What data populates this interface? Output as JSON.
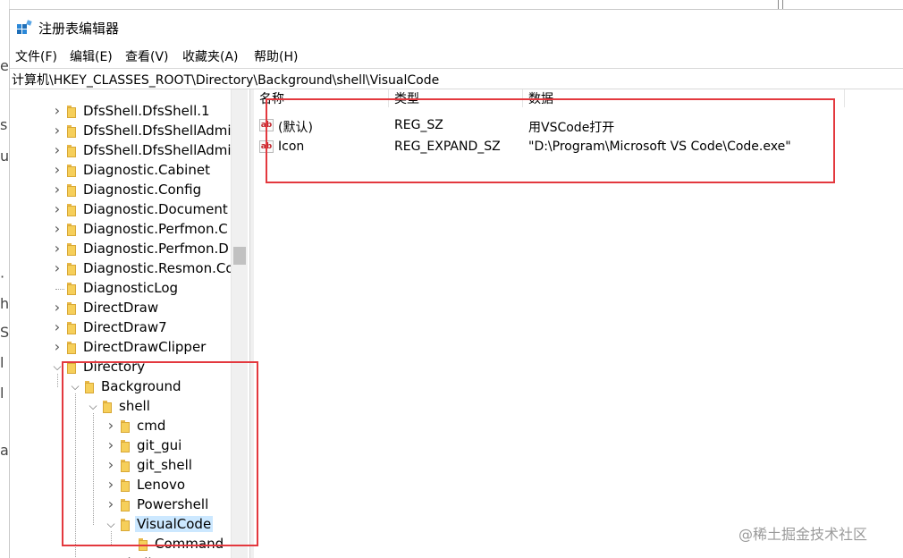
{
  "window": {
    "title": "注册表编辑器"
  },
  "menu": [
    "文件(F)",
    "编辑(E)",
    "查看(V)",
    "收藏夹(A)",
    "帮助(H)"
  ],
  "address": "计算机\\HKEY_CLASSES_ROOT\\Directory\\Background\\shell\\VisualCode",
  "tree": [
    {
      "label": "DfsShell.DfsShell.1",
      "level": 0,
      "expander": ">"
    },
    {
      "label": "DfsShell.DfsShellAdmi",
      "level": 0,
      "expander": ">"
    },
    {
      "label": "DfsShell.DfsShellAdmi",
      "level": 0,
      "expander": ">"
    },
    {
      "label": "Diagnostic.Cabinet",
      "level": 0,
      "expander": ">"
    },
    {
      "label": "Diagnostic.Config",
      "level": 0,
      "expander": ">"
    },
    {
      "label": "Diagnostic.Document",
      "level": 0,
      "expander": ">"
    },
    {
      "label": "Diagnostic.Perfmon.C",
      "level": 0,
      "expander": ">"
    },
    {
      "label": "Diagnostic.Perfmon.D",
      "level": 0,
      "expander": ">"
    },
    {
      "label": "Diagnostic.Resmon.Co",
      "level": 0,
      "expander": ">"
    },
    {
      "label": "DiagnosticLog",
      "level": 0,
      "expander": ""
    },
    {
      "label": "DirectDraw",
      "level": 0,
      "expander": ">"
    },
    {
      "label": "DirectDraw7",
      "level": 0,
      "expander": ">"
    },
    {
      "label": "DirectDrawClipper",
      "level": 0,
      "expander": ">"
    },
    {
      "label": "Directory",
      "level": 0,
      "expander": "v"
    },
    {
      "label": "Background",
      "level": 1,
      "expander": "v"
    },
    {
      "label": "shell",
      "level": 2,
      "expander": "v"
    },
    {
      "label": "cmd",
      "level": 3,
      "expander": ">"
    },
    {
      "label": "git_gui",
      "level": 3,
      "expander": ">"
    },
    {
      "label": "git_shell",
      "level": 3,
      "expander": ">"
    },
    {
      "label": "Lenovo",
      "level": 3,
      "expander": ">"
    },
    {
      "label": "Powershell",
      "level": 3,
      "expander": ">"
    },
    {
      "label": "VisualCode",
      "level": 3,
      "expander": "v",
      "selected": true
    },
    {
      "label": "Command",
      "level": 4,
      "expander": ""
    },
    {
      "label": "ShellEx",
      "level": 2,
      "expander": ">"
    }
  ],
  "columns": {
    "name": "名称",
    "type": "类型",
    "data": "数据"
  },
  "values": [
    {
      "name": "(默认)",
      "type": "REG_SZ",
      "data": "用VSCode打开"
    },
    {
      "name": "Icon",
      "type": "REG_EXPAND_SZ",
      "data": "\"D:\\Program\\Microsoft VS Code\\Code.exe\""
    }
  ],
  "watermark": "@稀土掘金技术社区",
  "colors": {
    "annotation": "#e3383e",
    "selection": "#cce8ff",
    "folder": "#f6cf5a"
  },
  "icons": {
    "app": "registry-editor-icon",
    "value": "string-value-icon",
    "folder": "folder-icon"
  }
}
